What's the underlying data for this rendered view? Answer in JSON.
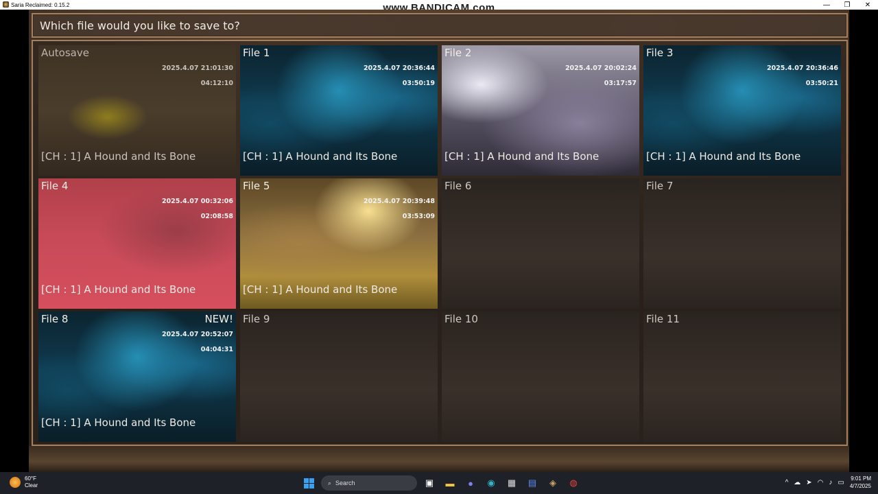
{
  "window": {
    "title": "Saria Reclaimed: 0.15.2",
    "watermark": "www.BANDICAM.com",
    "minimize_glyph": "—",
    "maximize_glyph": "❐",
    "close_glyph": "✕"
  },
  "prompt": "Which file would you like to save to?",
  "slots": [
    {
      "label": "Autosave",
      "date": "2025.4.07 21:01:30",
      "time": "04:12:10",
      "chapter": "[CH : 1] A Hound and Its Bone",
      "badge": ""
    },
    {
      "label": "File 1",
      "date": "2025.4.07 20:36:44",
      "time": "03:50:19",
      "chapter": "[CH : 1] A Hound and Its Bone",
      "badge": ""
    },
    {
      "label": "File 2",
      "date": "2025.4.07 20:02:24",
      "time": "03:17:57",
      "chapter": "[CH : 1] A Hound and Its Bone",
      "badge": ""
    },
    {
      "label": "File 3",
      "date": "2025.4.07 20:36:46",
      "time": "03:50:21",
      "chapter": "[CH : 1] A Hound and Its Bone",
      "badge": ""
    },
    {
      "label": "File 4",
      "date": "2025.4.07 00:32:06",
      "time": "02:08:58",
      "chapter": "[CH : 1] A Hound and Its Bone",
      "badge": ""
    },
    {
      "label": "File 5",
      "date": "2025.4.07 20:39:48",
      "time": "03:53:09",
      "chapter": "[CH : 1] A Hound and Its Bone",
      "badge": ""
    },
    {
      "label": "File 6",
      "date": "",
      "time": "",
      "chapter": "",
      "badge": ""
    },
    {
      "label": "File 7",
      "date": "",
      "time": "",
      "chapter": "",
      "badge": ""
    },
    {
      "label": "File 8",
      "date": "2025.4.07 20:52:07",
      "time": "04:04:31",
      "chapter": "[CH : 1] A Hound and Its Bone",
      "badge": "NEW!"
    },
    {
      "label": "File 9",
      "date": "",
      "time": "",
      "chapter": "",
      "badge": ""
    },
    {
      "label": "File 10",
      "date": "",
      "time": "",
      "chapter": "",
      "badge": ""
    },
    {
      "label": "File 11",
      "date": "",
      "time": "",
      "chapter": "",
      "badge": ""
    }
  ],
  "taskbar": {
    "weather_temp": "60°F",
    "weather_desc": "Clear",
    "search_label": "Search",
    "time": "9:01 PM",
    "date": "4/7/2025",
    "icons": [
      "windows-start-icon",
      "search-icon",
      "task-view-icon",
      "file-explorer-icon",
      "teams-icon",
      "edge-icon",
      "store-icon",
      "notepad-icon",
      "game-icon",
      "chrome-icon"
    ]
  }
}
